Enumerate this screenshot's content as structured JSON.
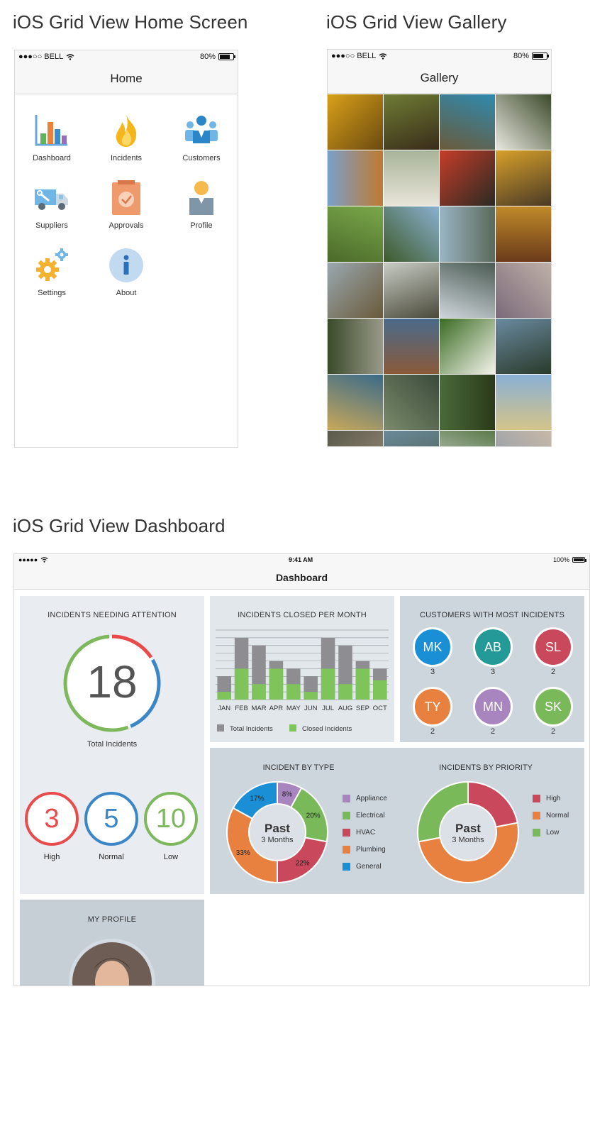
{
  "sections": {
    "home_title": "iOS Grid View Home Screen",
    "gallery_title": "iOS Grid View Gallery",
    "dashboard_title": "iOS Grid View Dashboard"
  },
  "home": {
    "status": {
      "carrier": "●●●○○ BELL",
      "battery": "80%",
      "battery_level": 0.8
    },
    "nav_title": "Home",
    "items": [
      {
        "label": "Dashboard",
        "icon": "bar-chart-icon"
      },
      {
        "label": "Incidents",
        "icon": "flame-icon"
      },
      {
        "label": "Customers",
        "icon": "people-icon"
      },
      {
        "label": "Suppliers",
        "icon": "truck-icon"
      },
      {
        "label": "Approvals",
        "icon": "clipboard-check-icon"
      },
      {
        "label": "Profile",
        "icon": "person-icon"
      },
      {
        "label": "Settings",
        "icon": "gears-icon"
      },
      {
        "label": "About",
        "icon": "info-icon"
      }
    ]
  },
  "gallery": {
    "status": {
      "carrier": "●●●○○ BELL",
      "battery": "80%",
      "battery_level": 0.8
    },
    "nav_title": "Gallery",
    "tiles": [
      [
        "#d9a019",
        "#6b4a10"
      ],
      [
        "#6e7c34",
        "#3a2c1a"
      ],
      [
        "#2f8ab0",
        "#6b5a3a"
      ],
      [
        "#e8e8e0",
        "#3c4a2a"
      ],
      [
        "#7aa0c8",
        "#c07a30"
      ],
      [
        "#a8b49a",
        "#e8e4d8"
      ],
      [
        "#c63d2a",
        "#2a2a22"
      ],
      [
        "#d7a02a",
        "#4a3a26"
      ],
      [
        "#7aa84a",
        "#4b6a2a"
      ],
      [
        "#3d5a2a",
        "#8ab0d0"
      ],
      [
        "#9ab4c4",
        "#5a6a5a"
      ],
      [
        "#c08a2a",
        "#6a3a1a"
      ],
      [
        "#9aa8b0",
        "#6a5a3a"
      ],
      [
        "#c8ccc4",
        "#4a4a3a"
      ],
      [
        "#4a5a52",
        "#cfd6dc"
      ],
      [
        "#7a6a7a",
        "#c0b0a8"
      ],
      [
        "#3a4a2a",
        "#9a9a8a"
      ],
      [
        "#4a6a8a",
        "#8a5a3a"
      ],
      [
        "#3a6a22",
        "#f4f4ec"
      ],
      [
        "#6a8aa0",
        "#2a3a2a"
      ],
      [
        "#3a6a8a",
        "#c8a85a"
      ],
      [
        "#7a8a6a",
        "#3a4a3a"
      ],
      [
        "#4a6a3a",
        "#2a3a1a"
      ],
      [
        "#8ab0d4",
        "#d4c48a"
      ],
      [
        "#5a5a4a",
        "#9a8a7a"
      ],
      [
        "#6a8a9a",
        "#4a5a4a"
      ],
      [
        "#5a7a4a",
        "#dadada"
      ],
      [
        "#8a9aaa",
        "#c8b8a8"
      ]
    ]
  },
  "dashboard": {
    "status": {
      "signal": "●●●●●",
      "time": "9:41 AM",
      "battery": "100%",
      "battery_level": 1.0
    },
    "nav_title": "Dashboard",
    "attention": {
      "title": "INCIDENTS NEEDING ATTENTION",
      "total": "18",
      "total_label": "Total Incidents",
      "breakdown": [
        {
          "value": "3",
          "label": "High",
          "color": "#e84b4b"
        },
        {
          "value": "5",
          "label": "Normal",
          "color": "#3b86c6"
        },
        {
          "value": "10",
          "label": "Low",
          "color": "#7db85c"
        }
      ]
    },
    "closed_chart_title": "INCIDENTS CLOSED PER MONTH",
    "customers": {
      "title": "CUSTOMERS WITH MOST INCIDENTS",
      "items": [
        {
          "initials": "MK",
          "count": "3",
          "color": "#1a8fd6"
        },
        {
          "initials": "AB",
          "count": "3",
          "color": "#239a97"
        },
        {
          "initials": "SL",
          "count": "2",
          "color": "#c9485b"
        },
        {
          "initials": "TY",
          "count": "2",
          "color": "#e8803f"
        },
        {
          "initials": "MN",
          "count": "2",
          "color": "#a985c0"
        },
        {
          "initials": "SK",
          "count": "2",
          "color": "#7ab95a"
        }
      ]
    },
    "type_title": "INCIDENT BY TYPE",
    "priority_title": "INCIDENTS BY PRIORITY",
    "donut_center": {
      "big": "Past",
      "small": "3 Months"
    },
    "profile_title": "MY PROFILE"
  },
  "chart_data": [
    {
      "type": "bar",
      "title": "INCIDENTS CLOSED PER MONTH",
      "categories": [
        "JAN",
        "FEB",
        "MAR",
        "APR",
        "MAY",
        "JUN",
        "JUL",
        "AUG",
        "SEP",
        "OCT"
      ],
      "series": [
        {
          "name": "Total Incidents",
          "color": "#8e8d91",
          "values": [
            3,
            8,
            7,
            5,
            4,
            3,
            8,
            7,
            5,
            4
          ]
        },
        {
          "name": "Closed Incidents",
          "color": "#7fc45a",
          "values": [
            1,
            4,
            2,
            4,
            2,
            1,
            4,
            2,
            4,
            2.5
          ]
        }
      ],
      "ylim": [
        0,
        9
      ],
      "grid": true,
      "legend": "bottom-left"
    },
    {
      "type": "pie",
      "title": "INCIDENT BY TYPE",
      "slices": [
        {
          "name": "Appliance",
          "value": 8,
          "label": "8%",
          "color": "#a985c0"
        },
        {
          "name": "Electrical",
          "value": 20,
          "label": "20%",
          "color": "#7ab95a"
        },
        {
          "name": "HVAC",
          "value": 22,
          "label": "22%",
          "color": "#c9485b"
        },
        {
          "name": "Plumbing",
          "value": 33,
          "label": "33%",
          "color": "#e8803f"
        },
        {
          "name": "General",
          "value": 17,
          "label": "17%",
          "color": "#1a8fd6"
        }
      ],
      "legend": "right"
    },
    {
      "type": "pie",
      "title": "INCIDENTS BY PRIORITY",
      "slices": [
        {
          "name": "High",
          "value": 22,
          "color": "#c9485b"
        },
        {
          "name": "Normal",
          "value": 50,
          "color": "#e8803f"
        },
        {
          "name": "Low",
          "value": 28,
          "color": "#7ab95a"
        }
      ],
      "legend": "right"
    }
  ]
}
